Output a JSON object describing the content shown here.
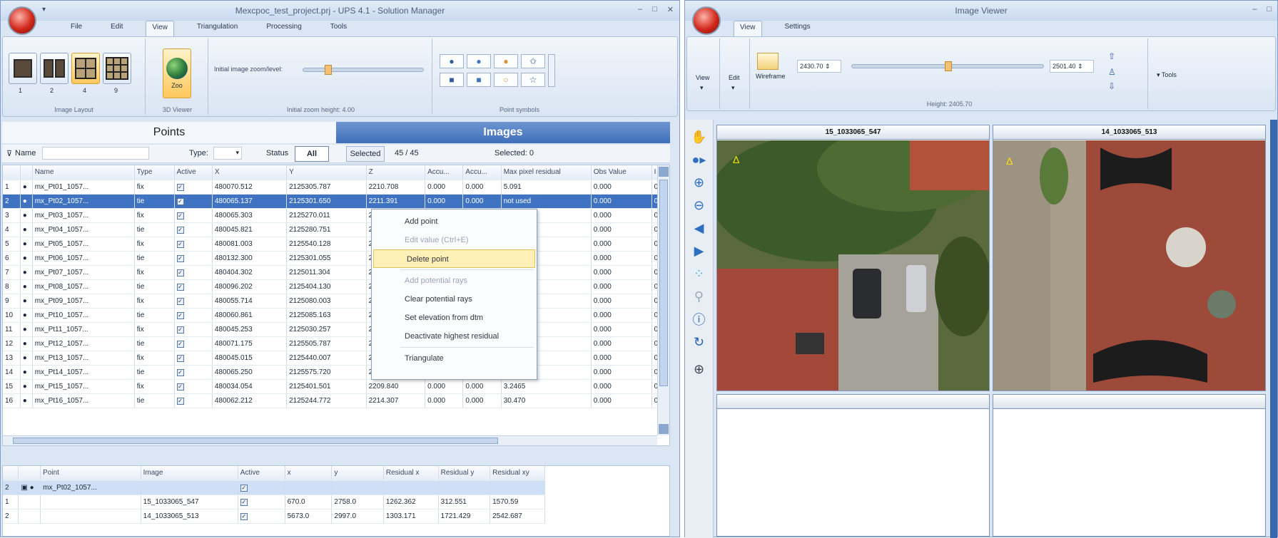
{
  "left_window": {
    "title": "Mexcpoc_test_project.prj - UPS 4.1 - Solution Manager",
    "qat": "▾",
    "controls": [
      "–",
      "□",
      "✕"
    ],
    "tabs": [
      "File",
      "Edit",
      "View",
      "Triangulation",
      "Processing",
      "Tools"
    ],
    "active_tab": "View",
    "ribbon": {
      "layout_buttons": [
        "1",
        "2",
        "4",
        "9"
      ],
      "layout_group": "Image Layout",
      "terrain_button": "Zoo",
      "terrain_group": "3D Viewer",
      "initial_zoom_label": "Initial image zoom/level:",
      "zoom_group": "Initial zoom height: 4.00",
      "symbol_group": "Point symbols"
    },
    "panel_headers": {
      "points": "Points",
      "images": "Images"
    },
    "filter": {
      "name_label": "Name",
      "type_label": "Type:",
      "type_value": "",
      "status_label": "Status",
      "all_button": "All",
      "selected_button": "Selected",
      "count": "45 / 45",
      "images_count": "Selected: 0"
    },
    "points_table": {
      "columns": [
        "",
        "",
        "Name",
        "Type",
        "Active",
        "X",
        "Y",
        "Z",
        "Accu...",
        "Accu...",
        "Max pixel residual",
        "Obs Value",
        "I"
      ],
      "rows": [
        [
          "1",
          "●",
          "mx_Pt01_1057...",
          "fix",
          "✓",
          "480070.512",
          "2125305.787",
          "2210.708",
          "0.000",
          "0.000",
          "5.091",
          "0.000",
          "0"
        ],
        [
          "2",
          "●",
          "mx_Pt02_1057...",
          "tie",
          "✓",
          "480065.137",
          "2125301.650",
          "2211.391",
          "0.000",
          "0.000",
          "not used",
          "0.000",
          "0"
        ],
        [
          "3",
          "●",
          "mx_Pt03_1057...",
          "fix",
          "✓",
          "480065.303",
          "2125270.011",
          "2211...",
          "0.000",
          "0.000",
          "",
          "0.000",
          "0"
        ],
        [
          "4",
          "●",
          "mx_Pt04_1057...",
          "tie",
          "✓",
          "480045.821",
          "2125280.751",
          "2210...",
          "0.000",
          "0.000",
          "",
          "0.000",
          "0"
        ],
        [
          "5",
          "●",
          "mx_Pt05_1057...",
          "fix",
          "✓",
          "480081.003",
          "2125540.128",
          "2210...",
          "0.000",
          "0.000",
          "",
          "0.000",
          "0"
        ],
        [
          "6",
          "●",
          "mx_Pt06_1057...",
          "tie",
          "✓",
          "480132.300",
          "2125301.055",
          "2212...",
          "0.000",
          "0.000",
          "",
          "0.000",
          "0"
        ],
        [
          "7",
          "●",
          "mx_Pt07_1057...",
          "fix",
          "✓",
          "480404.302",
          "2125011.304",
          "2212...",
          "0.000",
          "0.000",
          "",
          "0.000",
          "0"
        ],
        [
          "8",
          "●",
          "mx_Pt08_1057...",
          "tie",
          "✓",
          "480096.202",
          "2125404.130",
          "2211...",
          "0.000",
          "0.000",
          "",
          "0.000",
          "0"
        ],
        [
          "9",
          "●",
          "mx_Pt09_1057...",
          "fix",
          "✓",
          "480055.714",
          "2125080.003",
          "2213...",
          "0.000",
          "0.000",
          "",
          "0.000",
          "0"
        ],
        [
          "10",
          "●",
          "mx_Pt10_1057...",
          "tie",
          "✓",
          "480060.861",
          "2125085.163",
          "2213...",
          "0.000",
          "0.000",
          "",
          "0.000",
          "0"
        ],
        [
          "11",
          "●",
          "mx_Pt11_1057...",
          "fix",
          "✓",
          "480045.253",
          "2125030.257",
          "2214...",
          "0.000",
          "0.000",
          "",
          "0.000",
          "0"
        ],
        [
          "12",
          "●",
          "mx_Pt12_1057...",
          "tie",
          "✓",
          "480071.175",
          "2125505.787",
          "2210...",
          "0.000",
          "0.000",
          "",
          "0.000",
          "0"
        ],
        [
          "13",
          "●",
          "mx_Pt13_1057...",
          "fix",
          "✓",
          "480045.015",
          "2125440.007",
          "2210.101",
          "0.000",
          "0.000",
          "20.483",
          "0.000",
          "0"
        ],
        [
          "14",
          "●",
          "mx_Pt14_1057...",
          "tie",
          "✓",
          "480065.250",
          "2125575.720",
          "2211.508",
          "0.000",
          "0.000",
          "15.980",
          "0.000",
          "0"
        ],
        [
          "15",
          "●",
          "mx_Pt15_1057...",
          "fix",
          "✓",
          "480034.054",
          "2125401.501",
          "2209.840",
          "0.000",
          "0.000",
          "3.2465",
          "0.000",
          "0"
        ],
        [
          "16",
          "●",
          "mx_Pt16_1057...",
          "tie",
          "✓",
          "480062.212",
          "2125244.772",
          "2214.307",
          "0.000",
          "0.000",
          "30.470",
          "0.000",
          "0"
        ]
      ],
      "selected_row": 1
    },
    "context_menu": [
      {
        "label": "Add point",
        "state": "normal"
      },
      {
        "label": "Edit value (Ctrl+E)",
        "state": "disabled"
      },
      {
        "label": "Delete point",
        "state": "highlight"
      },
      {
        "label": "Add potential rays",
        "state": "disabled"
      },
      {
        "label": "Clear potential rays",
        "state": "normal"
      },
      {
        "label": "Set elevation from dtm",
        "state": "normal"
      },
      {
        "label": "Deactivate highest residual",
        "state": "normal"
      },
      {
        "label": "Triangulate",
        "state": "normal"
      }
    ],
    "obs_table": {
      "columns": [
        "",
        "",
        "Point",
        "Image",
        "Active",
        "x",
        "y",
        "Residual x",
        "Residual y",
        "Residual xy"
      ],
      "rows": [
        [
          "2",
          "▣ ●",
          "mx_Pt02_1057...",
          "",
          "✓",
          "",
          "",
          "",
          "",
          ""
        ],
        [
          "1",
          "",
          "",
          "15_1033065_547",
          "✓",
          "670.0",
          "2758.0",
          "1262.362",
          "312.551",
          "1570.59"
        ],
        [
          "2",
          "",
          "",
          "14_1033065_513",
          "✓",
          "5673.0",
          "2997.0",
          "1303.171",
          "1721.429",
          "2542.687"
        ]
      ]
    }
  },
  "right_window": {
    "title": "Image Viewer",
    "controls": [
      "–",
      "□"
    ],
    "tabs": [
      "View",
      "Settings"
    ],
    "ribbon": {
      "view_label": "View",
      "edit_label": "Edit",
      "zoom_in": "2430.70",
      "zoom_out": "2501.40",
      "window_label": "Wireframe",
      "height_group": "Height: 2405.70",
      "tools_label": "Tools"
    },
    "panes": [
      {
        "title": "15_1033065_547"
      },
      {
        "title": "14_1033065_513"
      },
      {
        "title": ""
      },
      {
        "title": ""
      }
    ]
  },
  "icons": {
    "hand": "hand-icon",
    "point_add": "point-add-icon",
    "zoom_in": "zoom-in-icon",
    "zoom_out": "zoom-out-icon",
    "back": "arrow-left-icon",
    "forward": "arrow-right-icon",
    "info": "info-icon",
    "crosshair": "crosshair-icon"
  },
  "colors": {
    "accent": "#3f72c0",
    "ribbon_active": "#ffc75a",
    "menu_highlight": "#fff0b5"
  }
}
